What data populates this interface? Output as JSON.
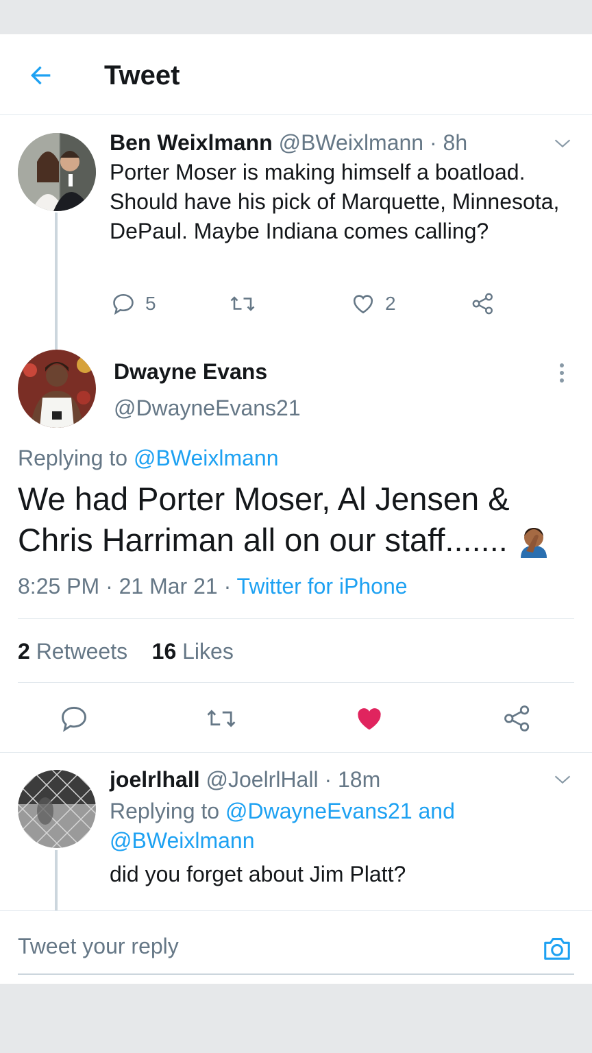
{
  "header": {
    "title": "Tweet"
  },
  "parent_tweet": {
    "name": "Ben Weixlmann",
    "handle": "@BWeixlmann",
    "time": "8h",
    "text": "Porter Moser is making himself a boatload. Should have his pick of Marquette, Minnesota, DePaul. Maybe Indiana comes calling?",
    "replies": "5",
    "likes": "2"
  },
  "main_tweet": {
    "name": "Dwayne Evans",
    "handle": "@DwayneEvans21",
    "replying_label": "Replying to",
    "replying_to": "@BWeixlmann",
    "text": "We had Porter Moser, Al Jensen & Chris Harriman all on our staff.......",
    "time": "8:25 PM",
    "date": "21 Mar 21",
    "source": "Twitter for iPhone",
    "retweets_count": "2",
    "retweets_label": "Retweets",
    "likes_count": "16",
    "likes_label": "Likes",
    "like_color": "#e0245e"
  },
  "reply_tweet": {
    "name": "joelrlhall",
    "handle": "@JoelrlHall",
    "time": "18m",
    "replying_label": "Replying to",
    "replying_to_1": "@DwayneEvans21",
    "replying_and": "and",
    "replying_to_2": "@BWeixlmann",
    "text": "did you forget about Jim Platt?"
  },
  "compose": {
    "placeholder": "Tweet your reply"
  },
  "colors": {
    "accent": "#1da1f2",
    "muted": "#657786",
    "text": "#14171a",
    "like": "#e0245e"
  },
  "icons": [
    "back-arrow-icon",
    "chevron-down-icon",
    "reply-icon",
    "retweet-icon",
    "like-icon",
    "share-icon",
    "more-vertical-icon",
    "camera-icon",
    "facepalm-emoji"
  ]
}
